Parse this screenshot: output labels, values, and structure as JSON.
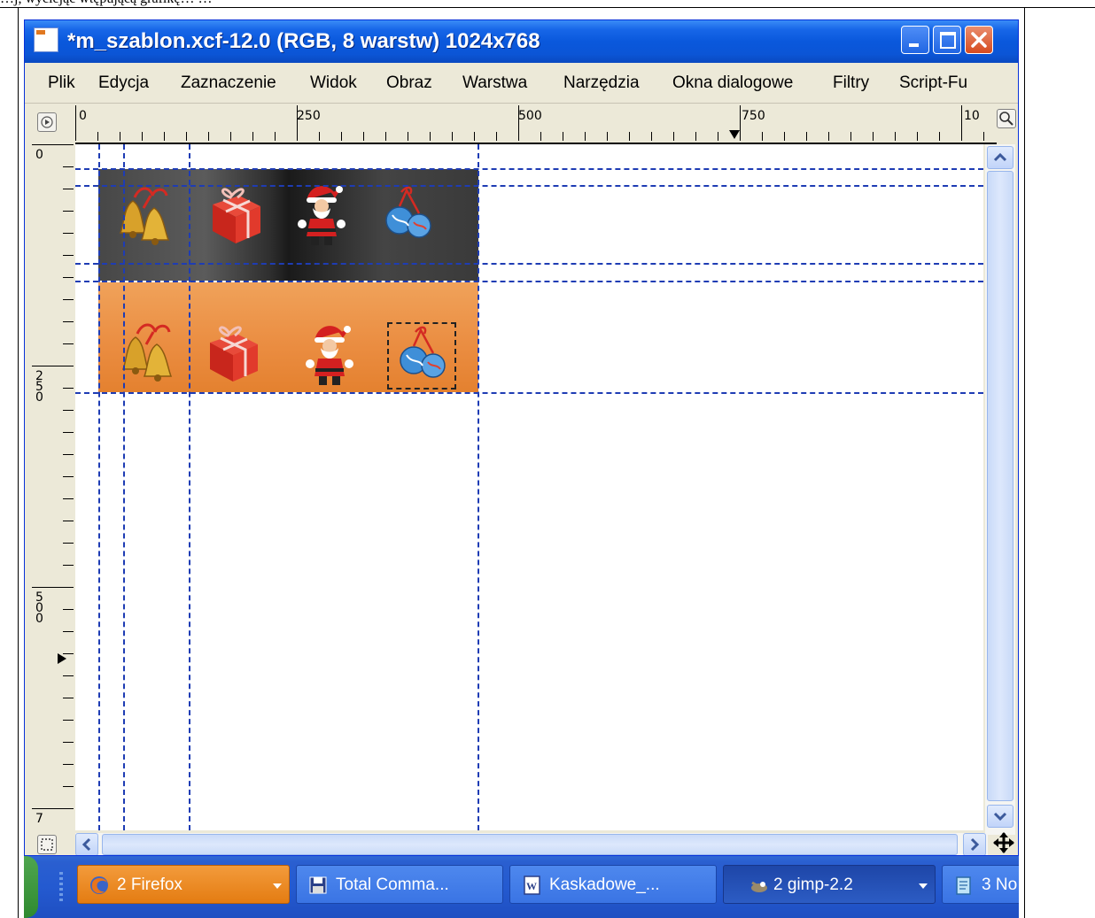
{
  "document": {
    "top_text": "…j, wyciejąc wtępującą grafikę…  …"
  },
  "window": {
    "title": "*m_szablon.xcf-12.0 (RGB, 8 warstw) 1024x768"
  },
  "menu": {
    "items": [
      {
        "label": "Plik"
      },
      {
        "label": "Edycja"
      },
      {
        "label": "Zaznaczenie"
      },
      {
        "label": "Widok"
      },
      {
        "label": "Obraz"
      },
      {
        "label": "Warstwa"
      },
      {
        "label": "Narzędzia"
      },
      {
        "label": "Okna dialogowe"
      },
      {
        "label": "Filtry"
      },
      {
        "label": "Script-Fu"
      }
    ]
  },
  "ruler_h": {
    "labels": [
      "0",
      "250",
      "500",
      "750",
      "10"
    ]
  },
  "ruler_v": {
    "labels": [
      "0",
      "250",
      "500",
      "7"
    ]
  },
  "canvas": {
    "icons": [
      "bells-icon",
      "gift-icon",
      "santa-icon",
      "ornaments-icon"
    ]
  },
  "taskbar": {
    "tasks": [
      {
        "label": "2 Firefox"
      },
      {
        "label": "Total Comma..."
      },
      {
        "label": "Kaskadowe_..."
      },
      {
        "label": "2 gimp-2.2"
      },
      {
        "label": "3 No"
      }
    ]
  },
  "colors": {
    "title_bar": "#0a58dc",
    "guide": "#1e3cb4",
    "band_dark": "#3a3a3a",
    "band_orange": "#ea8c40",
    "taskbar": "#245ad0",
    "task_active": "#e47c12"
  }
}
